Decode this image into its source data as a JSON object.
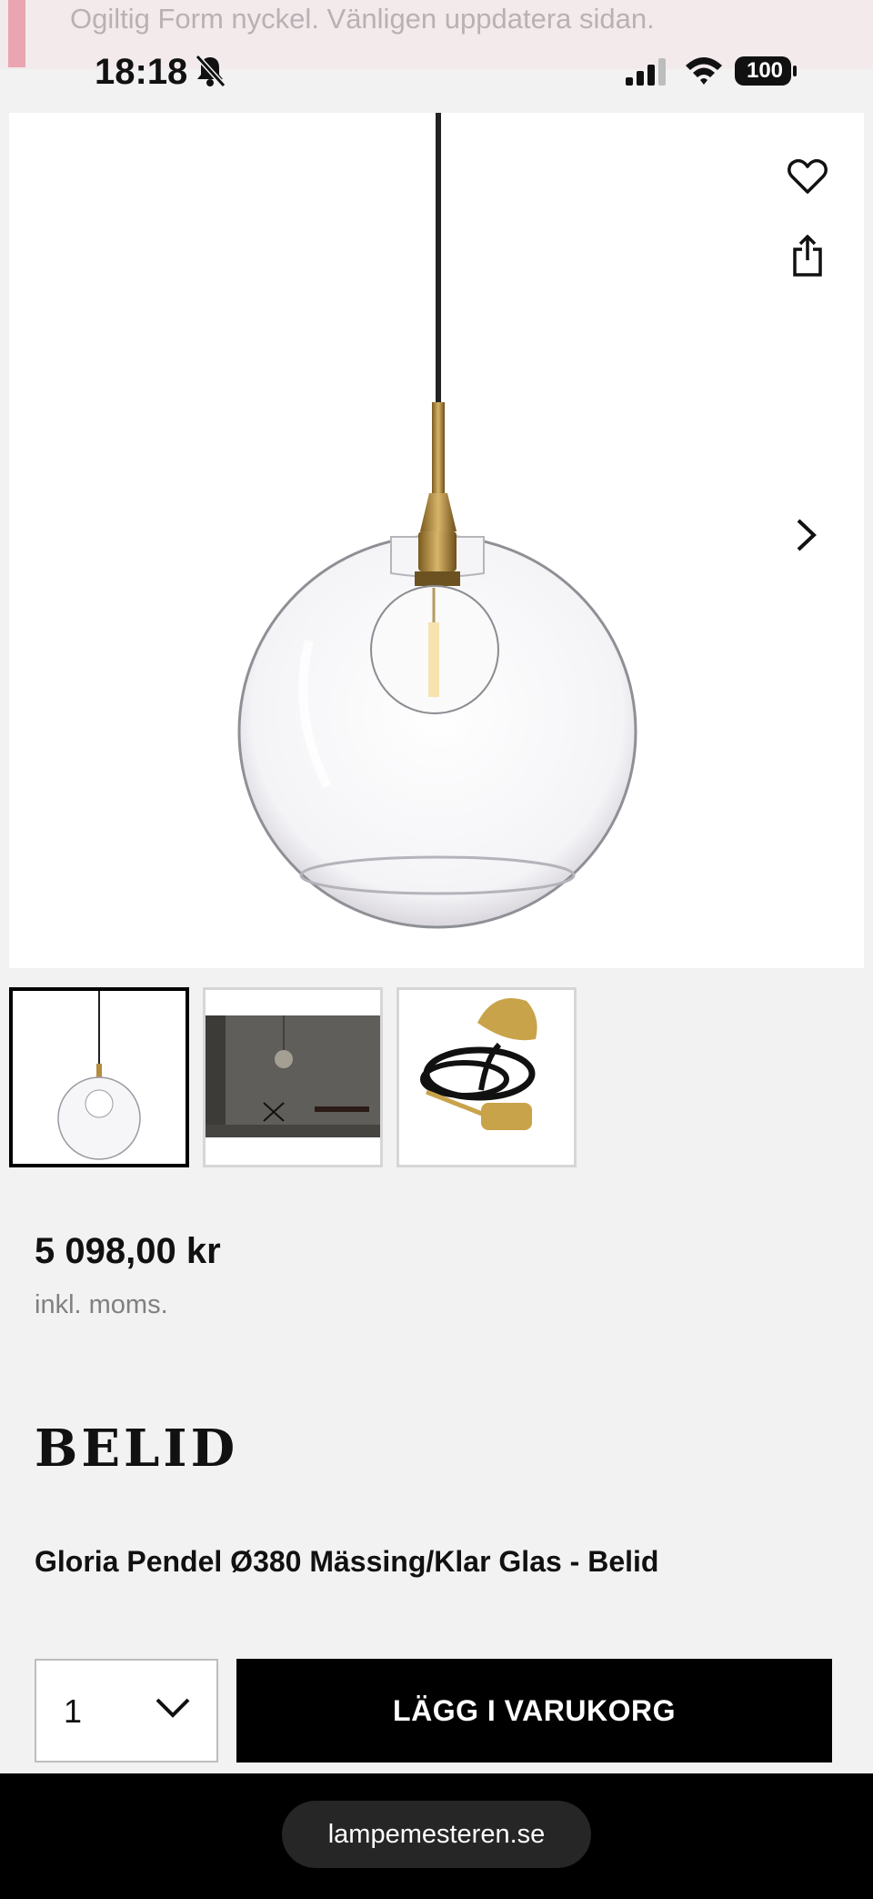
{
  "alert": {
    "message": "Ogiltig Form nyckel. Vänligen uppdatera sidan."
  },
  "status_bar": {
    "time": "18:18",
    "battery": "100",
    "icons": [
      "bell-off-icon",
      "signal-icon",
      "wifi-icon",
      "battery-icon"
    ]
  },
  "gallery": {
    "actions": [
      "heart-icon",
      "share-icon",
      "chevron-right-icon"
    ],
    "thumbnails": [
      "pendant-lamp-photo",
      "room-scene-photo",
      "brass-cord-set-photo"
    ],
    "active_thumbnail": 0
  },
  "product": {
    "price": "5 098,00 kr",
    "vat_note": "inkl. moms.",
    "brand": "BELID",
    "title": "Gloria Pendel Ø380 Mässing/Klar Glas - Belid"
  },
  "cart": {
    "quantity": "1",
    "add_label": "LÄGG I VARUKORG"
  },
  "browser": {
    "url": "lampemesteren.se"
  },
  "colors": {
    "alert_bg": "#f3eaec",
    "alert_accent": "#e9a5b1",
    "button_bg": "#000000",
    "page_bg": "#f2f2f2"
  }
}
